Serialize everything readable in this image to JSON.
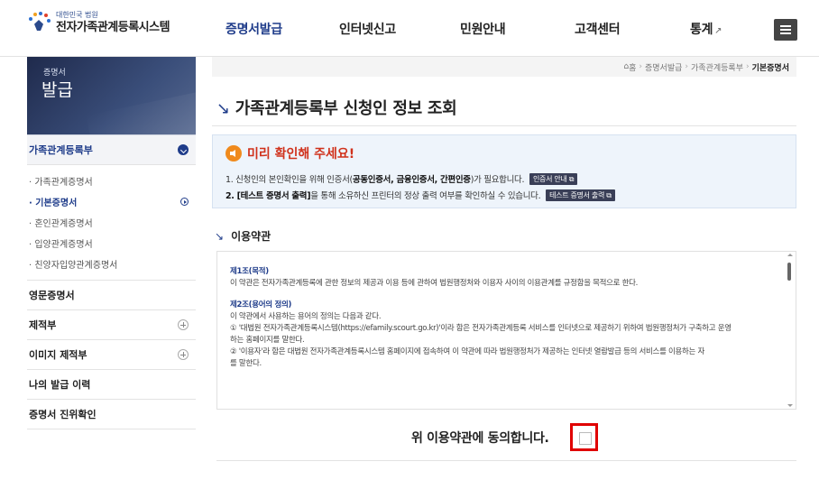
{
  "header": {
    "logo_small": "대한민국 법원",
    "logo_title": "전자가족관계등록시스템",
    "nav": [
      {
        "label": "증명서발급",
        "active": true
      },
      {
        "label": "인터넷신고",
        "active": false
      },
      {
        "label": "민원안내",
        "active": false
      },
      {
        "label": "고객센터",
        "active": false
      },
      {
        "label": "통계",
        "active": false
      }
    ],
    "menu_icon": "hamburger-icon",
    "ext_icon": "↗"
  },
  "sidebar": {
    "banner_small": "증명서",
    "banner_big": "발급",
    "groups": [
      {
        "label": "가족관계등록부",
        "open": true,
        "items": [
          {
            "label": "· 가족관계증명서",
            "active": false
          },
          {
            "label": "· 기본증명서",
            "active": true
          },
          {
            "label": "· 혼인관계증명서",
            "active": false
          },
          {
            "label": "· 입양관계증명서",
            "active": false
          },
          {
            "label": "· 친양자입양관계증명서",
            "active": false
          }
        ]
      },
      {
        "label": "영문증명서"
      },
      {
        "label": "제적부"
      },
      {
        "label": "이미지 제적부"
      },
      {
        "label": "나의 발급 이력"
      },
      {
        "label": "증명서 진위확인"
      }
    ]
  },
  "breadcrumb": {
    "home": "홈",
    "level1": "증명서발급",
    "level2": "가족관계등록부",
    "current": "기본증명서"
  },
  "page": {
    "title": "가족관계등록부 신청인 정보 조회"
  },
  "notice": {
    "title": "미리 확인해 주세요!",
    "line1_pre": "1. 신청인의 본인확인을 위해 인증서(",
    "line1_bold": "공동인증서, 금융인증서, 간편인증",
    "line1_post": ")가 필요합니다.",
    "btn1": "인증서 안내",
    "line2_bold": "2. [테스트 증명서 출력]",
    "line2_post": "을 통해 소유하신 프린터의 정상 출력 여부를 확인하실 수 있습니다.",
    "btn2": "테스트 증명서 출력"
  },
  "terms": {
    "section_title": "이용약관",
    "art1_title": "제1조(목적)",
    "art1_text": "이 약관은 전자가족관계등록에 관한 정보의 제공과 이용 등에 관하여 법원행정처와 이용자 사이의 이용관계를 규정함을 목적으로 한다.",
    "art2_title": "제2조(용어의 정의)",
    "art2_intro": "이 약관에서 사용하는 용어의 정의는 다음과 같다.",
    "art2_item1_a": "① '대법원 전자가족관계등록시스템(https://efamily.scourt.go.kr)'이라 함은 전자가족관계등록 서비스를 인터넷으로 제공하기 위하여 법원행정처가 구축하고 운영",
    "art2_item1_b": "하는 홈페이지를 말한다.",
    "art2_item2_a": "② '이용자'라 함은 대법원 전자가족관계등록시스템 홈페이지에 접속하여 이 약관에 따라 법원행정처가 제공하는 인터넷 열람발급 등의 서비스를 이용하는 자",
    "art2_item2_b": "를 말한다."
  },
  "agree": {
    "label": "위 이용약관에 동의합니다.",
    "checked": false
  }
}
